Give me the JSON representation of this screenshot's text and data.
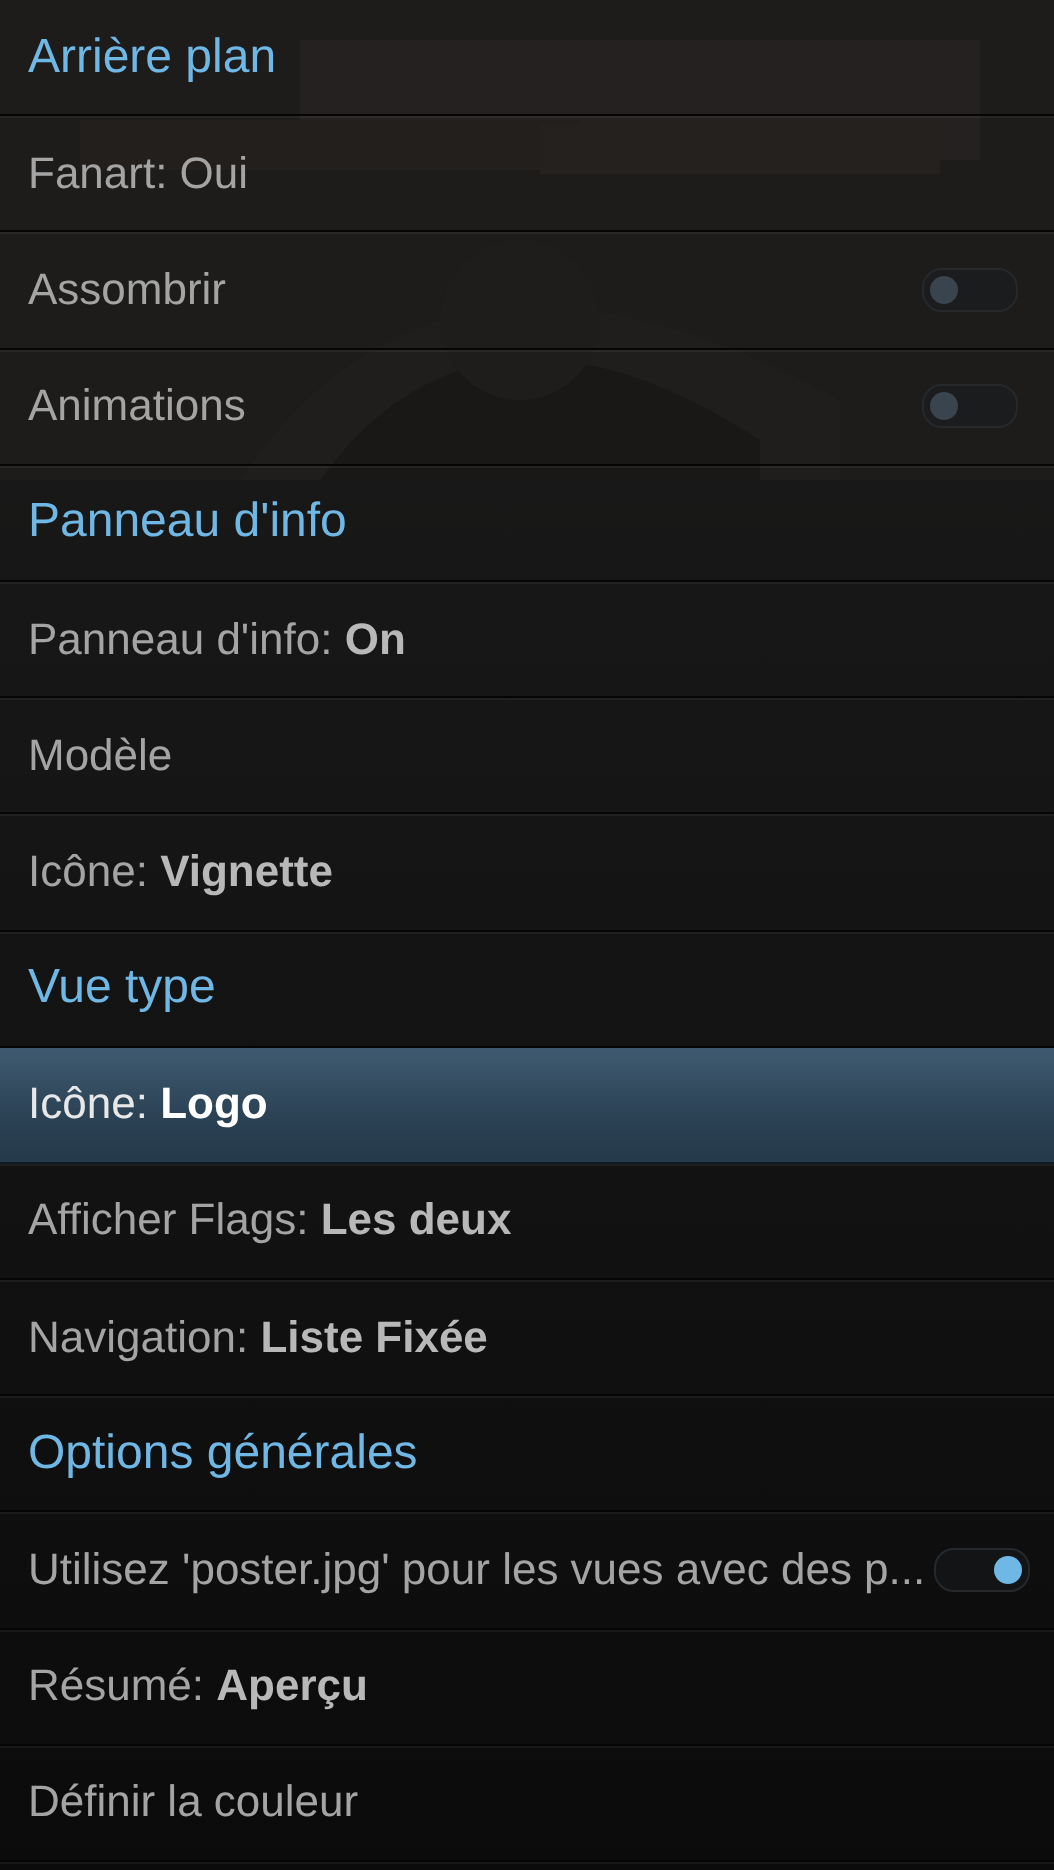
{
  "items": [
    {
      "kind": "header",
      "label": "Arrière plan"
    },
    {
      "kind": "text",
      "label": "Fanart: Oui",
      "selected": false
    },
    {
      "kind": "toggle",
      "label": "Assombrir",
      "on": false,
      "selected": false
    },
    {
      "kind": "toggle",
      "label": "Animations",
      "on": false,
      "selected": false
    },
    {
      "kind": "header",
      "label": "Panneau d'info"
    },
    {
      "kind": "text",
      "label": "Panneau d'info:",
      "value": "On",
      "selected": false
    },
    {
      "kind": "text",
      "label": "Modèle",
      "selected": false
    },
    {
      "kind": "text",
      "label": "Icône:",
      "value": "Vignette",
      "selected": false
    },
    {
      "kind": "header",
      "label": "Vue type"
    },
    {
      "kind": "text",
      "label": "Icône:",
      "value": "Logo",
      "selected": true
    },
    {
      "kind": "text",
      "label": "Afficher Flags:",
      "value": "Les deux",
      "selected": false
    },
    {
      "kind": "text",
      "label": "Navigation:",
      "value": "Liste Fixée",
      "selected": false
    },
    {
      "kind": "header",
      "label": "Options générales"
    },
    {
      "kind": "toggle",
      "label": "Utilisez 'poster.jpg' pour les vues avec des p...",
      "on": true,
      "selected": false
    },
    {
      "kind": "text",
      "label": "Résumé:",
      "value": "Aperçu",
      "selected": false
    },
    {
      "kind": "text",
      "label": "Définir la couleur",
      "selected": false
    }
  ]
}
